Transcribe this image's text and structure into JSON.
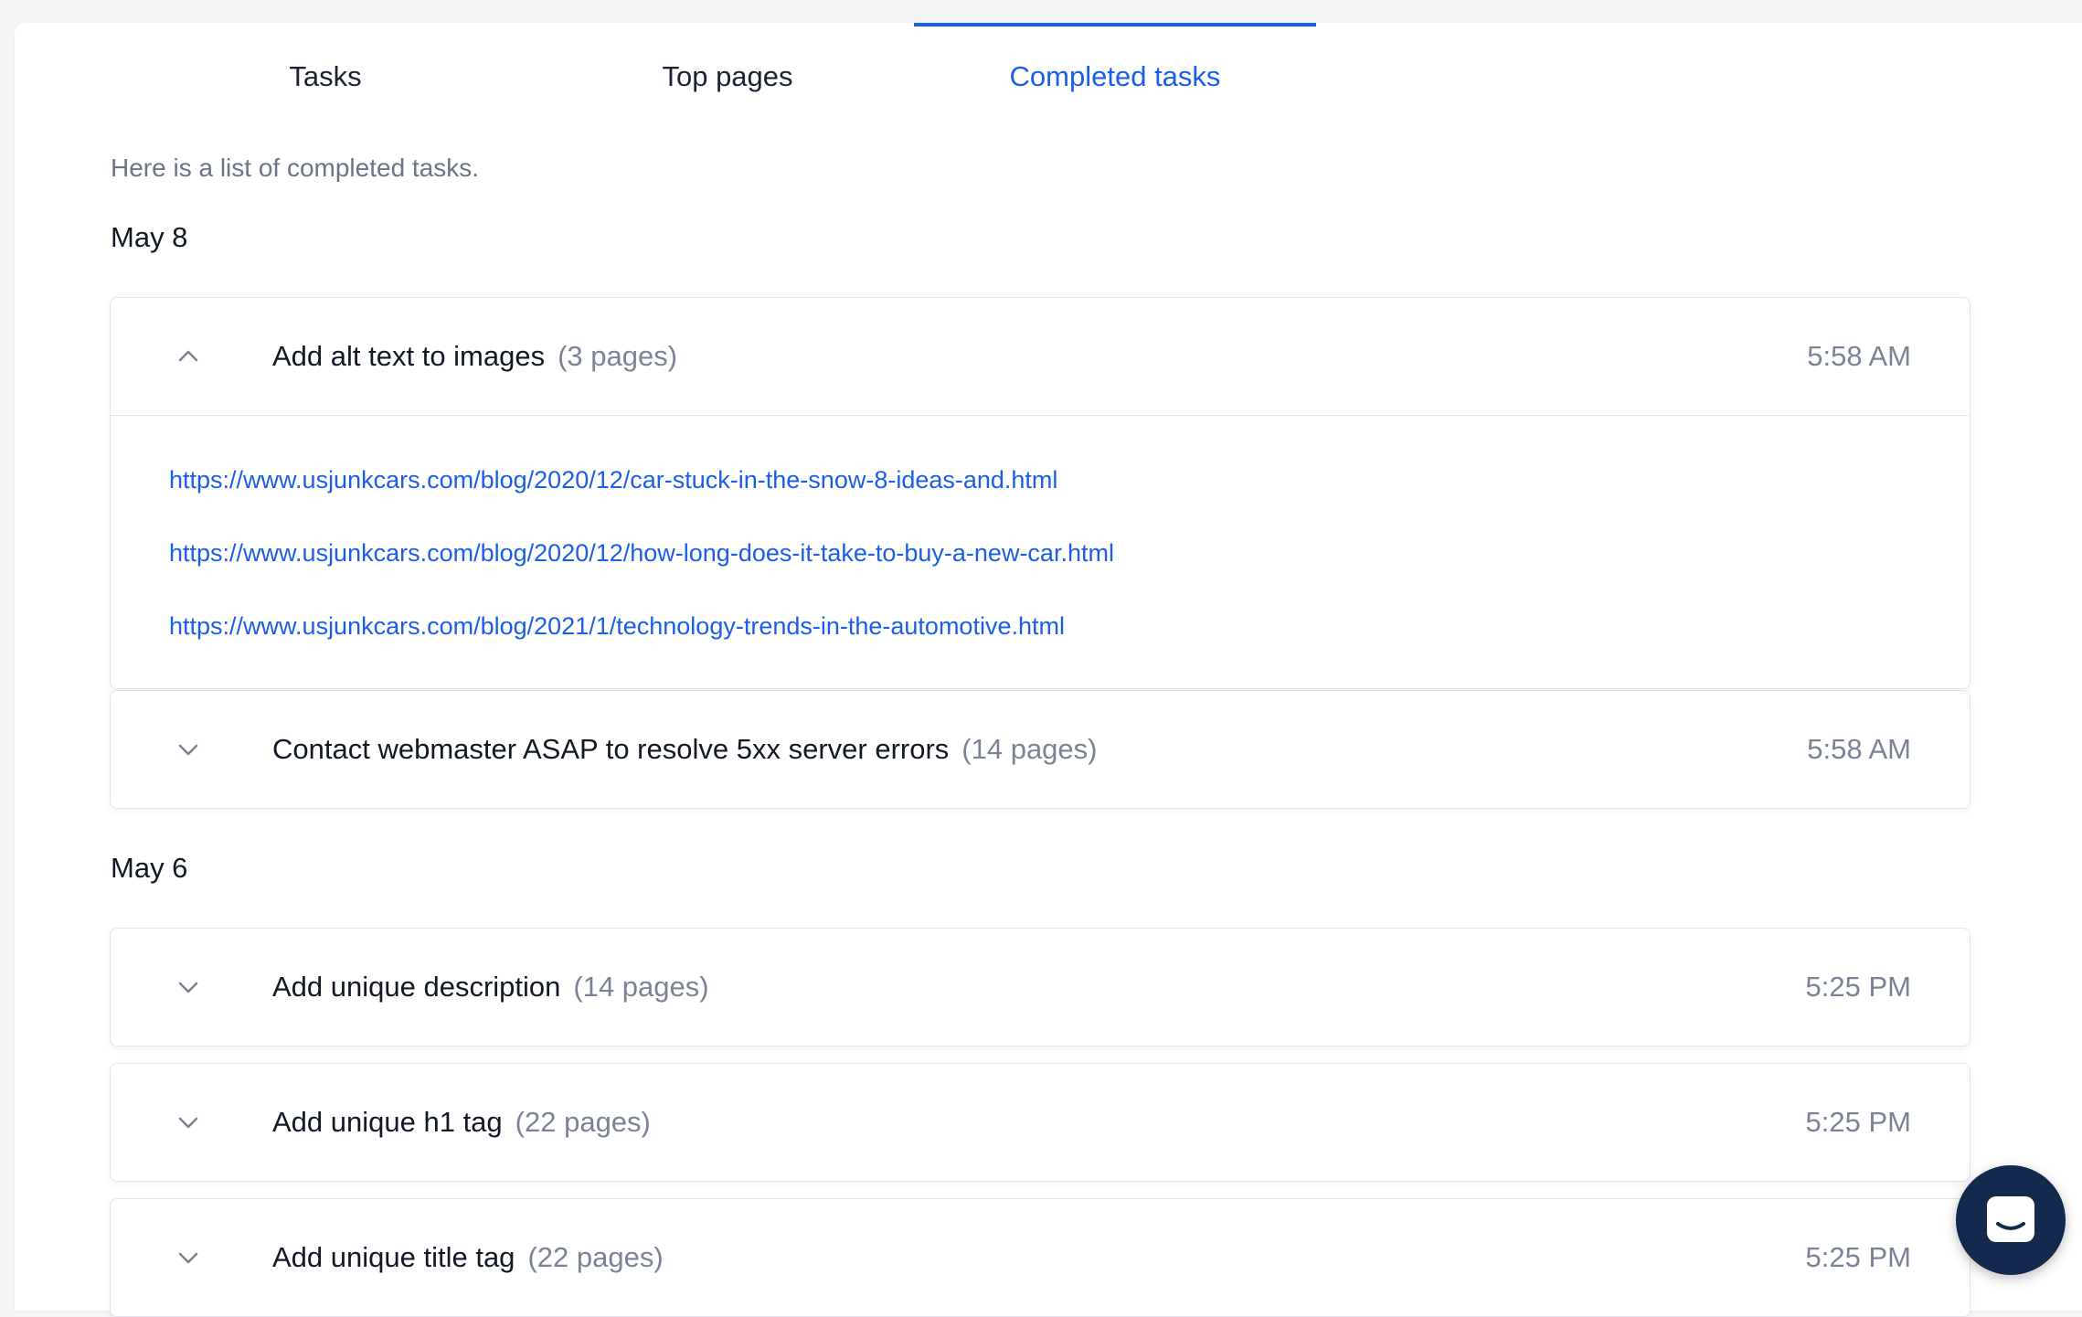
{
  "tabs": [
    {
      "label": "Tasks"
    },
    {
      "label": "Top pages"
    },
    {
      "label": "Completed tasks"
    }
  ],
  "active_tab": "Completed tasks",
  "intro": "Here is a list of completed tasks.",
  "groups": [
    {
      "date": "May 8",
      "tasks": [
        {
          "title": "Add alt text to images",
          "count": "(3 pages)",
          "time": "5:58 AM",
          "expanded": true,
          "pages": [
            "https://www.usjunkcars.com/blog/2020/12/car-stuck-in-the-snow-8-ideas-and.html",
            "https://www.usjunkcars.com/blog/2020/12/how-long-does-it-take-to-buy-a-new-car.html",
            "https://www.usjunkcars.com/blog/2021/1/technology-trends-in-the-automotive.html"
          ]
        },
        {
          "title": "Contact webmaster ASAP to resolve 5xx server errors",
          "count": "(14 pages)",
          "time": "5:58 AM",
          "expanded": false
        }
      ]
    },
    {
      "date": "May 6",
      "tasks": [
        {
          "title": "Add unique description",
          "count": "(14 pages)",
          "time": "5:25 PM",
          "expanded": false
        },
        {
          "title": "Add unique h1 tag",
          "count": "(22 pages)",
          "time": "5:25 PM",
          "expanded": false
        },
        {
          "title": "Add unique title tag",
          "count": "(22 pages)",
          "time": "5:25 PM",
          "expanded": false
        }
      ]
    }
  ],
  "icons": {
    "expanded": "chevron-up-icon",
    "collapsed": "chevron-down-icon",
    "chat": "chat-icon"
  },
  "colors": {
    "accent": "#1a5fe6",
    "text": "#121826",
    "muted": "#7a8396",
    "border": "#e2e6ec",
    "chat_button": "#13294d"
  }
}
